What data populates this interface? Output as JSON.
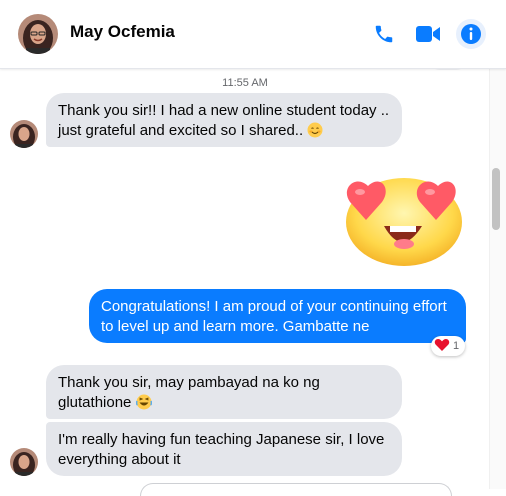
{
  "header": {
    "contact_name": "May Ocfemia",
    "icons": [
      "phone-icon",
      "video-camera-icon",
      "info-icon"
    ],
    "accent_color": "#0a7cff"
  },
  "conversation": {
    "timestamp": "11:55 AM",
    "messages": [
      {
        "sender": "contact",
        "text": "Thank you sir!! I had a new online student today .. just grateful and excited so I shared..",
        "emoji": "smiling-face-icon"
      },
      {
        "sender": "me",
        "sticker": "heart-eyes-emoji"
      },
      {
        "sender": "me",
        "text": "Congratulations! I am proud of your continuing effort to level up and learn more. Gambatte ne",
        "reaction": {
          "emoji": "heart-icon",
          "count": "1"
        }
      },
      {
        "sender": "contact",
        "text": "Thank you sir, may pambayad na ko ng glutathione",
        "emoji": "laughing-face-icon"
      },
      {
        "sender": "contact",
        "text": "I'm really having fun teaching Japanese sir, I love everything about it"
      }
    ]
  }
}
